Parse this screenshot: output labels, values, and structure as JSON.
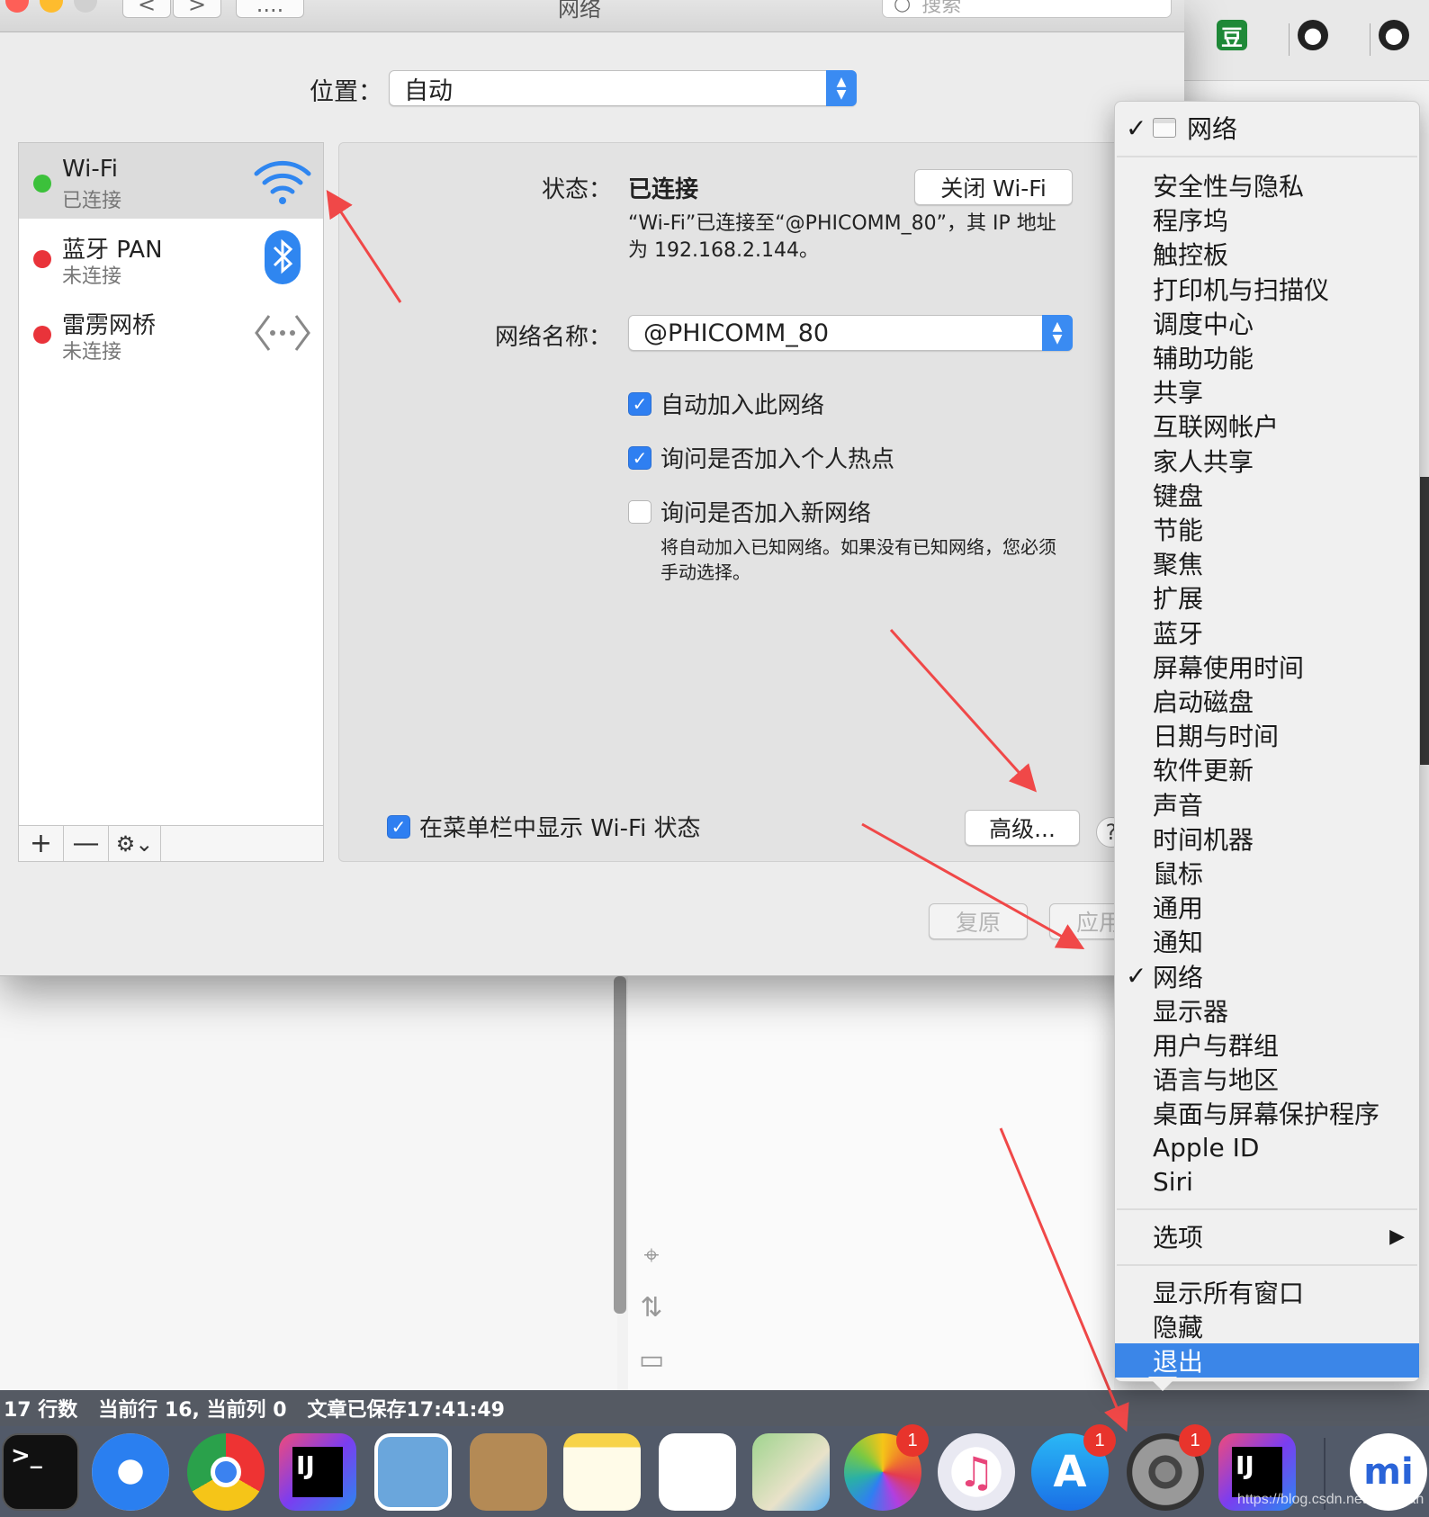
{
  "window": {
    "title": "网络",
    "search_placeholder": "搜索",
    "more_label": "....",
    "back_glyph": "<",
    "forward_glyph": ">"
  },
  "location": {
    "label": "位置：",
    "value": "自动"
  },
  "services": [
    {
      "name": "Wi-Fi",
      "status": "已连接",
      "color": "#3cc13b",
      "icon": "wifi-icon"
    },
    {
      "name": "蓝牙 PAN",
      "status": "未连接",
      "color": "#e9333a",
      "icon": "bluetooth-icon"
    },
    {
      "name": "雷雳网桥",
      "status": "未连接",
      "color": "#e9333a",
      "icon": "thunderbolt-bridge-icon"
    }
  ],
  "service_toolbar": {
    "add": "+",
    "remove": "—",
    "gear": "⚙⌄"
  },
  "detail": {
    "status_label": "状态：",
    "status_value": "已连接",
    "turn_off_button": "关闭 Wi-Fi",
    "status_desc_line1": "“Wi-Fi”已连接至“@PHICOMM_80”，其 IP 地址",
    "status_desc_line2": "为 192.168.2.144。",
    "network_name_label": "网络名称：",
    "network_name_value": "@PHICOMM_80",
    "auto_join": {
      "label": "自动加入此网络",
      "checked": true
    },
    "ask_hotspot": {
      "label": "询问是否加入个人热点",
      "checked": true
    },
    "ask_new": {
      "label": "询问是否加入新网络",
      "checked": false
    },
    "ask_new_desc_line1": "将自动加入已知网络。如果没有已知网络，您必须",
    "ask_new_desc_line2": "手动选择。",
    "show_in_menubar": {
      "label": "在菜单栏中显示 Wi-Fi 状态",
      "checked": true
    },
    "advanced_button": "高级...",
    "help": "?",
    "revert_button": "复原",
    "apply_button": "应用"
  },
  "context_menu": {
    "header": "网络",
    "panes": [
      "安全性与隐私",
      "程序坞",
      "触控板",
      "打印机与扫描仪",
      "调度中心",
      "辅助功能",
      "共享",
      "互联网帐户",
      "家人共享",
      "键盘",
      "节能",
      "聚焦",
      "扩展",
      "蓝牙",
      "屏幕使用时间",
      "启动磁盘",
      "日期与时间",
      "软件更新",
      "声音",
      "时间机器",
      "鼠标",
      "通用",
      "通知",
      "网络",
      "显示器",
      "用户与群组",
      "语言与地区",
      "桌面与屏幕保护程序",
      "Apple ID",
      "Siri"
    ],
    "checked_pane": "网络",
    "options": "选项",
    "show_all_windows": "显示所有窗口",
    "hide": "隐藏",
    "quit": "退出",
    "highlight_color": "#3b86e8"
  },
  "statusbar": {
    "text": "17 行数   当前行 16, 当前列 0   文章已保存17:41:49"
  },
  "browser_tabs": {
    "douban": "豆"
  },
  "dock": {
    "items": [
      {
        "name": "terminal-icon",
        "label": ">_"
      },
      {
        "name": "safari-icon"
      },
      {
        "name": "chrome-icon"
      },
      {
        "name": "intellij-icon",
        "label": "IJ"
      },
      {
        "name": "preview-icon"
      },
      {
        "name": "contacts-icon"
      },
      {
        "name": "notes-icon"
      },
      {
        "name": "reminders-icon"
      },
      {
        "name": "maps-icon"
      },
      {
        "name": "photos-icon",
        "badge": "1"
      },
      {
        "name": "itunes-icon"
      },
      {
        "name": "app-store-icon",
        "badge": "1"
      },
      {
        "name": "system-preferences-icon",
        "badge": "1"
      },
      {
        "name": "intellij-icon-2",
        "label": "IJ"
      },
      {
        "name": "mi-icon"
      }
    ],
    "watermark": "https://blog.csdn.net/cmqwan"
  },
  "accent_color": "#3a8bf2"
}
